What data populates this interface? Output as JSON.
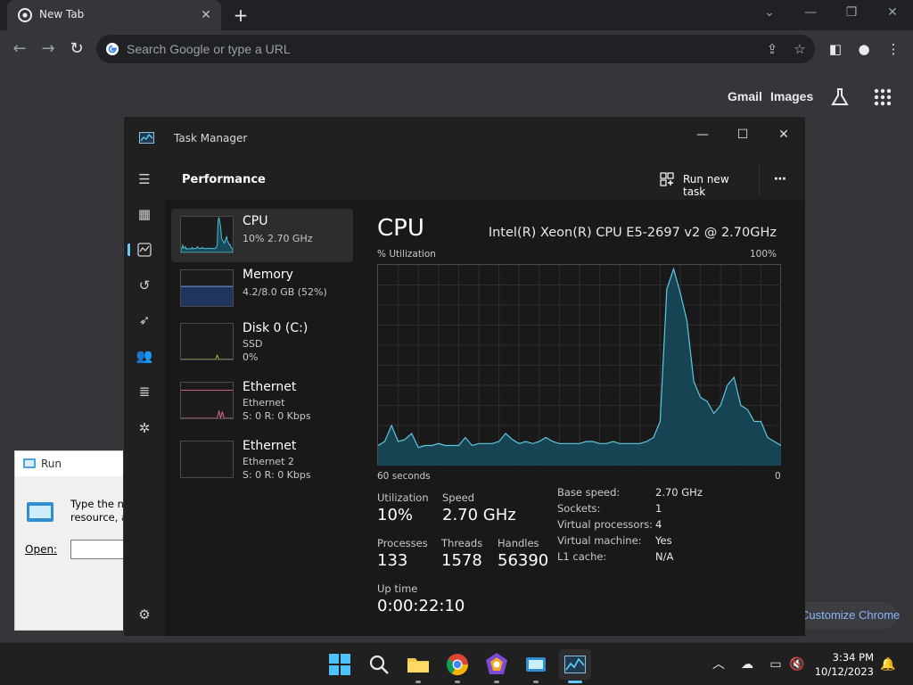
{
  "chrome": {
    "tab_title": "New Tab",
    "omnibox_placeholder": "Search Google or type a URL",
    "ntp": {
      "gmail": "Gmail",
      "images": "Images",
      "customize": "Customize Chrome"
    }
  },
  "run_dialog": {
    "title": "Run",
    "description_line1": "Type the na",
    "description_line2": "resource, a",
    "open_label": "Open:"
  },
  "task_manager": {
    "title": "Task Manager",
    "page_title": "Performance",
    "run_new_task": "Run new task",
    "items": [
      {
        "name": "CPU",
        "sub1": "10% 2.70 GHz",
        "sub2": "",
        "color": "#4cc2d9"
      },
      {
        "name": "Memory",
        "sub1": "4.2/8.0 GB (52%)",
        "sub2": "",
        "color": "#6b9be8"
      },
      {
        "name": "Disk 0 (C:)",
        "sub1": "SSD",
        "sub2": "0%",
        "color": "#9ac84a"
      },
      {
        "name": "Ethernet",
        "sub1": "Ethernet",
        "sub2": "S: 0 R: 0 Kbps",
        "color": "#e06b8c"
      },
      {
        "name": "Ethernet",
        "sub1": "Ethernet 2",
        "sub2": "S: 0 R: 0 Kbps",
        "color": "#e06b8c"
      }
    ],
    "detail": {
      "title": "CPU",
      "model": "Intel(R) Xeon(R) CPU E5-2697 v2 @ 2.70GHz",
      "y_label": "% Utilization",
      "y_max_label": "100%",
      "x_left_label": "60 seconds",
      "x_right_label": "0",
      "stats": {
        "utilization_label": "Utilization",
        "utilization": "10%",
        "speed_label": "Speed",
        "speed": "2.70 GHz",
        "processes_label": "Processes",
        "processes": "133",
        "threads_label": "Threads",
        "threads": "1578",
        "handles_label": "Handles",
        "handles": "56390",
        "uptime_label": "Up time",
        "uptime": "0:00:22:10"
      },
      "specs": [
        {
          "label": "Base speed:",
          "value": "2.70 GHz"
        },
        {
          "label": "Sockets:",
          "value": "1"
        },
        {
          "label": "Virtual processors:",
          "value": "4"
        },
        {
          "label": "Virtual machine:",
          "value": "Yes"
        },
        {
          "label": "L1 cache:",
          "value": "N/A"
        }
      ]
    },
    "accent": "#60cdff",
    "graph_line": "#5fc8e0",
    "graph_fill": "#17495a"
  },
  "chart_data": {
    "type": "area",
    "y_unit": "% Utilization",
    "ylim": [
      0,
      100
    ],
    "x_range_seconds": 60,
    "values": [
      10,
      12,
      20,
      12,
      13,
      16,
      9,
      10,
      10,
      11,
      10,
      10,
      10,
      14,
      10,
      11,
      11,
      11,
      12,
      16,
      13,
      11,
      12,
      11,
      12,
      14,
      12,
      11,
      11,
      11,
      11,
      12,
      12,
      11,
      11,
      12,
      11,
      11,
      11,
      11,
      12,
      14,
      22,
      88,
      98,
      86,
      72,
      42,
      34,
      32,
      26,
      30,
      40,
      44,
      30,
      28,
      22,
      22,
      14,
      12,
      10
    ],
    "grid": true
  },
  "taskbar": {
    "time": "3:34 PM",
    "date": "10/12/2023"
  }
}
